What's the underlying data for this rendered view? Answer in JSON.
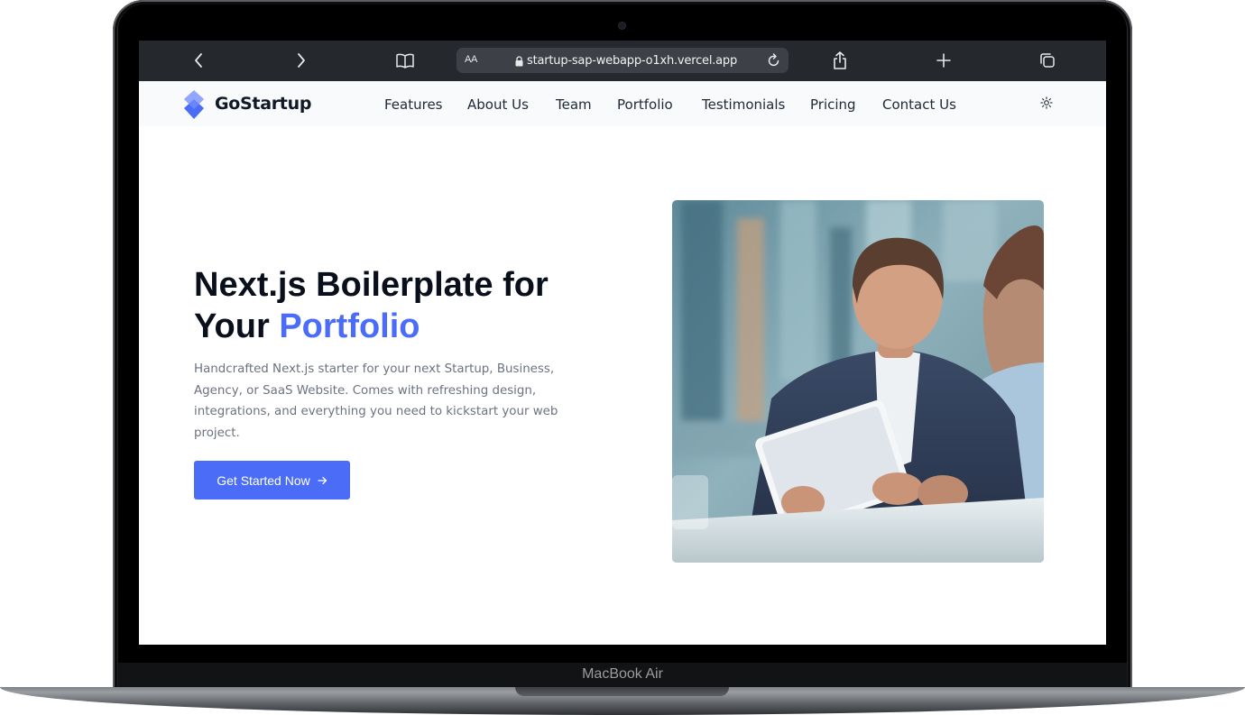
{
  "device": {
    "label": "MacBook Air"
  },
  "browser": {
    "aa_label": "AA",
    "url": "startup-sap-webapp-o1xh.vercel.app",
    "icons": [
      "back-icon",
      "forward-icon",
      "book-icon",
      "lock-icon",
      "reload-icon",
      "share-icon",
      "new-tab-icon",
      "tabs-icon"
    ]
  },
  "header": {
    "logo_text": "GoStartup",
    "nav": [
      "Features",
      "About Us",
      "Team",
      "Portfolio",
      "Testimonials",
      "Pricing",
      "Contact Us"
    ],
    "theme_icon": "sun-icon"
  },
  "hero": {
    "title_line1": "Next.js Boilerplate for",
    "title_line2_prefix": "Your",
    "title_line2_accent": "Portfolio",
    "description": "Handcrafted Next.js starter for your next Startup, Business, Agency, or SaaS Website. Comes with refreshing design, integrations, and everything you need to kickstart your web project.",
    "cta_label": "Get Started Now",
    "cta_icon": "arrow-right-icon"
  },
  "colors": {
    "accent": "#4a6cf7",
    "heading": "#0a0f1c",
    "body_text": "#6b7280",
    "safari_bar": "#25282d"
  }
}
